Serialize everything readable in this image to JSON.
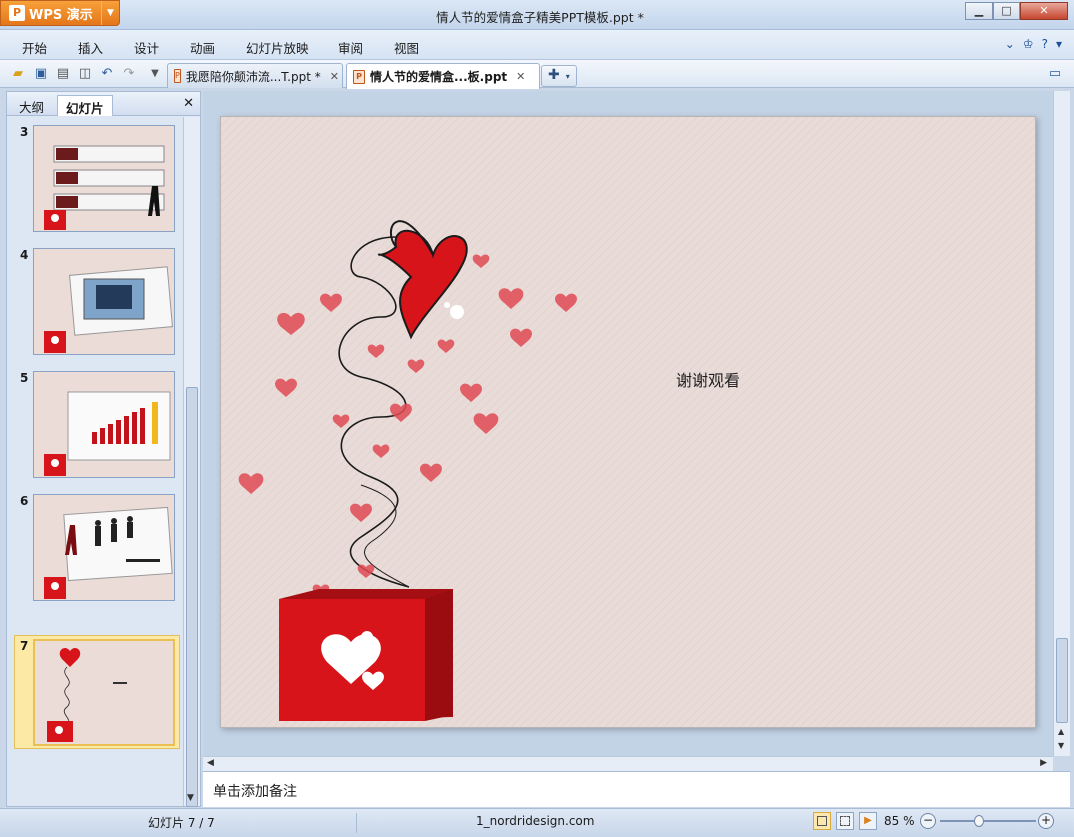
{
  "app": {
    "name": "WPS 演示",
    "window_title": "情人节的爱情盒子精美PPT模板.ppt *"
  },
  "menu": {
    "items": [
      "开始",
      "插入",
      "设计",
      "动画",
      "幻灯片放映",
      "审阅",
      "视图"
    ]
  },
  "tabs": [
    {
      "label": "我愿陪你颠沛流...T.ppt *",
      "active": false
    },
    {
      "label": "情人节的爱情盒...板.ppt",
      "active": true
    }
  ],
  "panel": {
    "tab_outline": "大纲",
    "tab_slides": "幻灯片"
  },
  "thumbnails": [
    {
      "num": "3"
    },
    {
      "num": "4"
    },
    {
      "num": "5"
    },
    {
      "num": "6"
    },
    {
      "num": "7",
      "selected": true
    }
  ],
  "slide": {
    "text": "谢谢观看"
  },
  "notes": {
    "placeholder": "单击添加备注"
  },
  "status": {
    "slide_counter": "幻灯片 7 / 7",
    "template": "1_nordridesign.com",
    "zoom": "85 %"
  },
  "colors": {
    "accent": "#e4761a",
    "heart_red": "#d7141a",
    "slide_bg": "#e9dcd8",
    "chrome": "#c9d7e8"
  }
}
